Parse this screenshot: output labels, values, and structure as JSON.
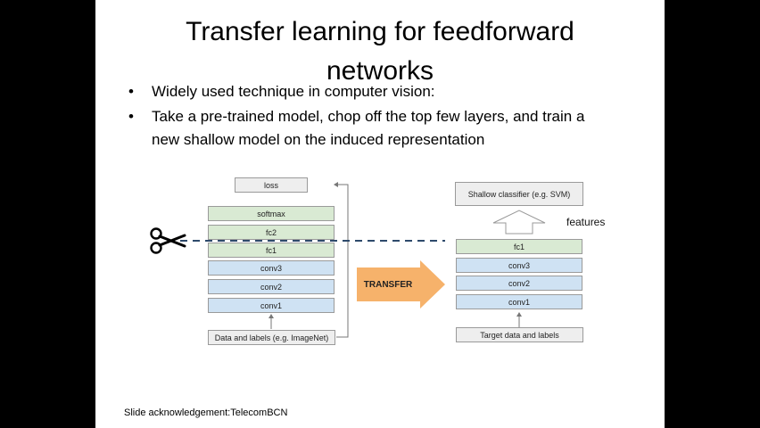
{
  "slide": {
    "title_line1": "Transfer learning for feedforward",
    "title_line2": "networks",
    "bullets": [
      "Widely used technique in computer vision:",
      "Take a pre-trained model, chop off the top few layers, and train a new shallow model on the induced representation"
    ],
    "acknowledgement": "Slide acknowledgement:TelecomBCN"
  },
  "left_model": {
    "layers": [
      "loss",
      "softmax",
      "fc2",
      "fc1",
      "conv3",
      "conv2",
      "conv1"
    ],
    "input": "Data and labels (e.g. ImageNet)"
  },
  "transfer_label": "TRANSFER",
  "right_model": {
    "classifier": "Shallow classifier (e.g. SVM)",
    "features_label": "features",
    "layers": [
      "fc1",
      "conv3",
      "conv2",
      "conv1"
    ],
    "input": "Target data and labels"
  },
  "icons": {
    "cut": "scissors-icon"
  },
  "colors": {
    "dense_layer": "#d9ead3",
    "conv_layer": "#cfe2f3",
    "loss_box": "#eeeeee",
    "transfer_arrow": "#f6b26b",
    "cut_line": "#2e4a6b"
  }
}
